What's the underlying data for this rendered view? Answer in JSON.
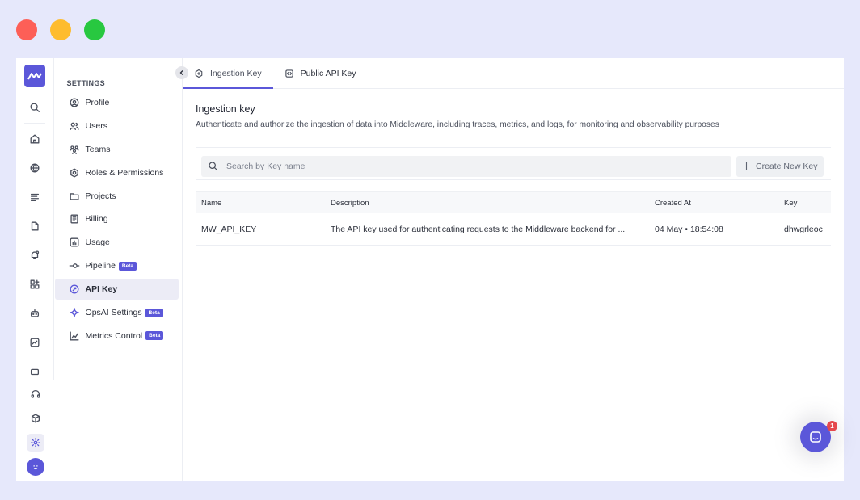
{
  "window_controls": [
    "close",
    "minimize",
    "maximize"
  ],
  "rail": {
    "logo": "middleware-logo",
    "icons": [
      "search-icon",
      "home-icon",
      "globe-icon",
      "list-icon",
      "file-icon",
      "alert-icon",
      "dashboard-icon",
      "robot-icon",
      "analytics-icon",
      "more-icon"
    ],
    "bottom_icons": [
      "headset-icon",
      "box-icon",
      "gear-icon"
    ]
  },
  "sidebar": {
    "title": "SETTINGS",
    "items": [
      {
        "label": "Profile",
        "icon": "profile-icon"
      },
      {
        "label": "Users",
        "icon": "users-icon"
      },
      {
        "label": "Teams",
        "icon": "teams-icon"
      },
      {
        "label": "Roles & Permissions",
        "icon": "roles-icon"
      },
      {
        "label": "Projects",
        "icon": "projects-icon"
      },
      {
        "label": "Billing",
        "icon": "billing-icon"
      },
      {
        "label": "Usage",
        "icon": "usage-icon"
      },
      {
        "label": "Pipeline",
        "icon": "pipeline-icon",
        "badge": "Beta"
      },
      {
        "label": "API Key",
        "icon": "api-key-icon",
        "active": true
      },
      {
        "label": "OpsAI Settings",
        "icon": "sparkle-icon",
        "badge": "Beta"
      },
      {
        "label": "Metrics Control",
        "icon": "metrics-icon",
        "badge": "Beta"
      }
    ]
  },
  "tabs": [
    {
      "label": "Ingestion Key",
      "active": true
    },
    {
      "label": "Public API Key",
      "active": false
    }
  ],
  "content": {
    "title": "Ingestion key",
    "subtitle": "Authenticate and authorize the ingestion of data into Middleware, including traces, metrics, and logs, for monitoring and observability purposes"
  },
  "search": {
    "placeholder": "Search by Key name",
    "value": ""
  },
  "create_button": {
    "label": "Create New Key"
  },
  "table": {
    "headers": [
      "Name",
      "Description",
      "Created At",
      "Key"
    ],
    "rows": [
      [
        "MW_API_KEY",
        "The API key used for authenticating requests to the Middleware backend for ...",
        "04 May • 18:54:08",
        "dhwgrleoc"
      ]
    ]
  },
  "chat": {
    "badge": "1"
  },
  "colors": {
    "accent": "#5b57d9",
    "badge": "#e5484d"
  }
}
